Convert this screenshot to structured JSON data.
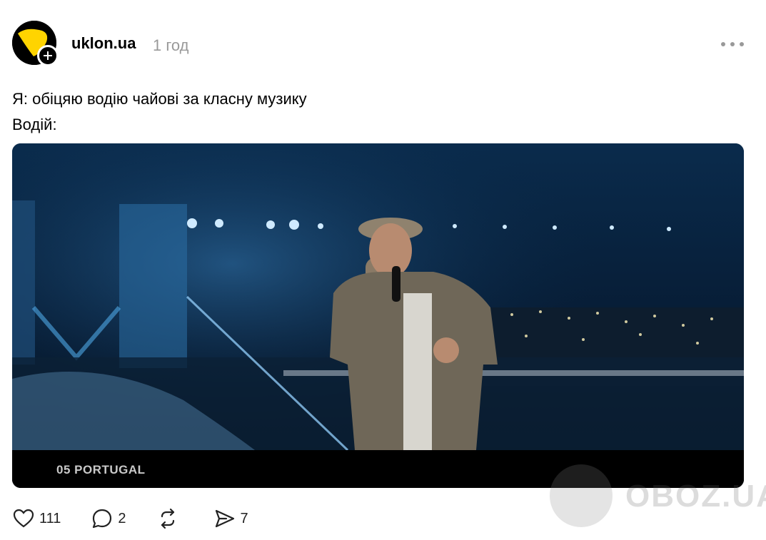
{
  "post": {
    "username": "uklon.ua",
    "time": "1 год",
    "caption_lines": [
      "Я: обіцяю водію чайові за класну музику",
      "Водій:"
    ],
    "media_caption": "05 PORTUGAL",
    "likes": "111",
    "comments": "2",
    "shares": "7"
  },
  "watermark": {
    "text": "OBOZ.UA"
  },
  "icons": {
    "avatar": "uklon-logo-icon",
    "follow": "plus-icon",
    "more": "more-dots-icon",
    "like": "heart-icon",
    "comment": "comment-bubble-icon",
    "repost": "repost-icon",
    "share": "send-icon"
  },
  "colors": {
    "brand_yellow": "#FFD400",
    "muted_text": "#999999"
  }
}
